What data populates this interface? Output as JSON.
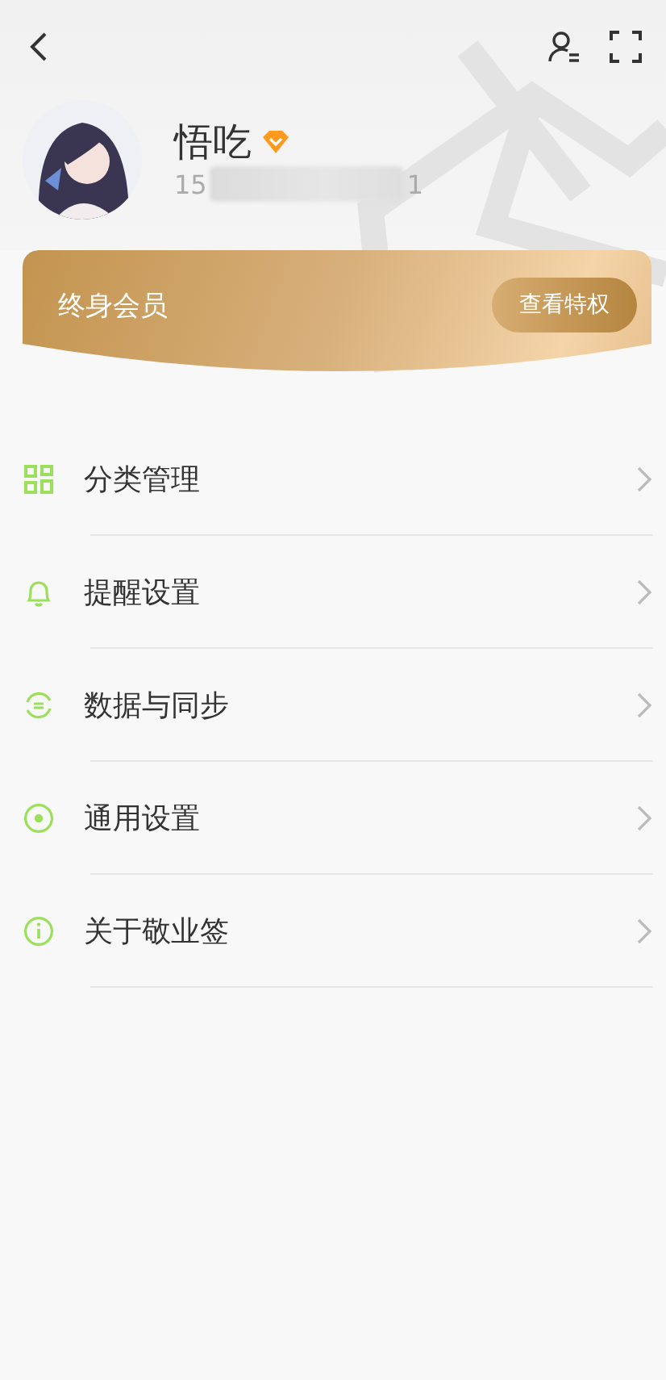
{
  "profile": {
    "name": "悟吃",
    "vip_badge": true,
    "phone_start": "15",
    "phone_end": "1"
  },
  "membership": {
    "title": "终身会员",
    "button": "查看特权"
  },
  "menu": [
    {
      "kind": "grid",
      "label": "分类管理"
    },
    {
      "kind": "bell",
      "label": "提醒设置"
    },
    {
      "kind": "sync",
      "label": "数据与同步"
    },
    {
      "kind": "dot",
      "label": "通用设置"
    },
    {
      "kind": "info",
      "label": "关于敬业签"
    }
  ]
}
